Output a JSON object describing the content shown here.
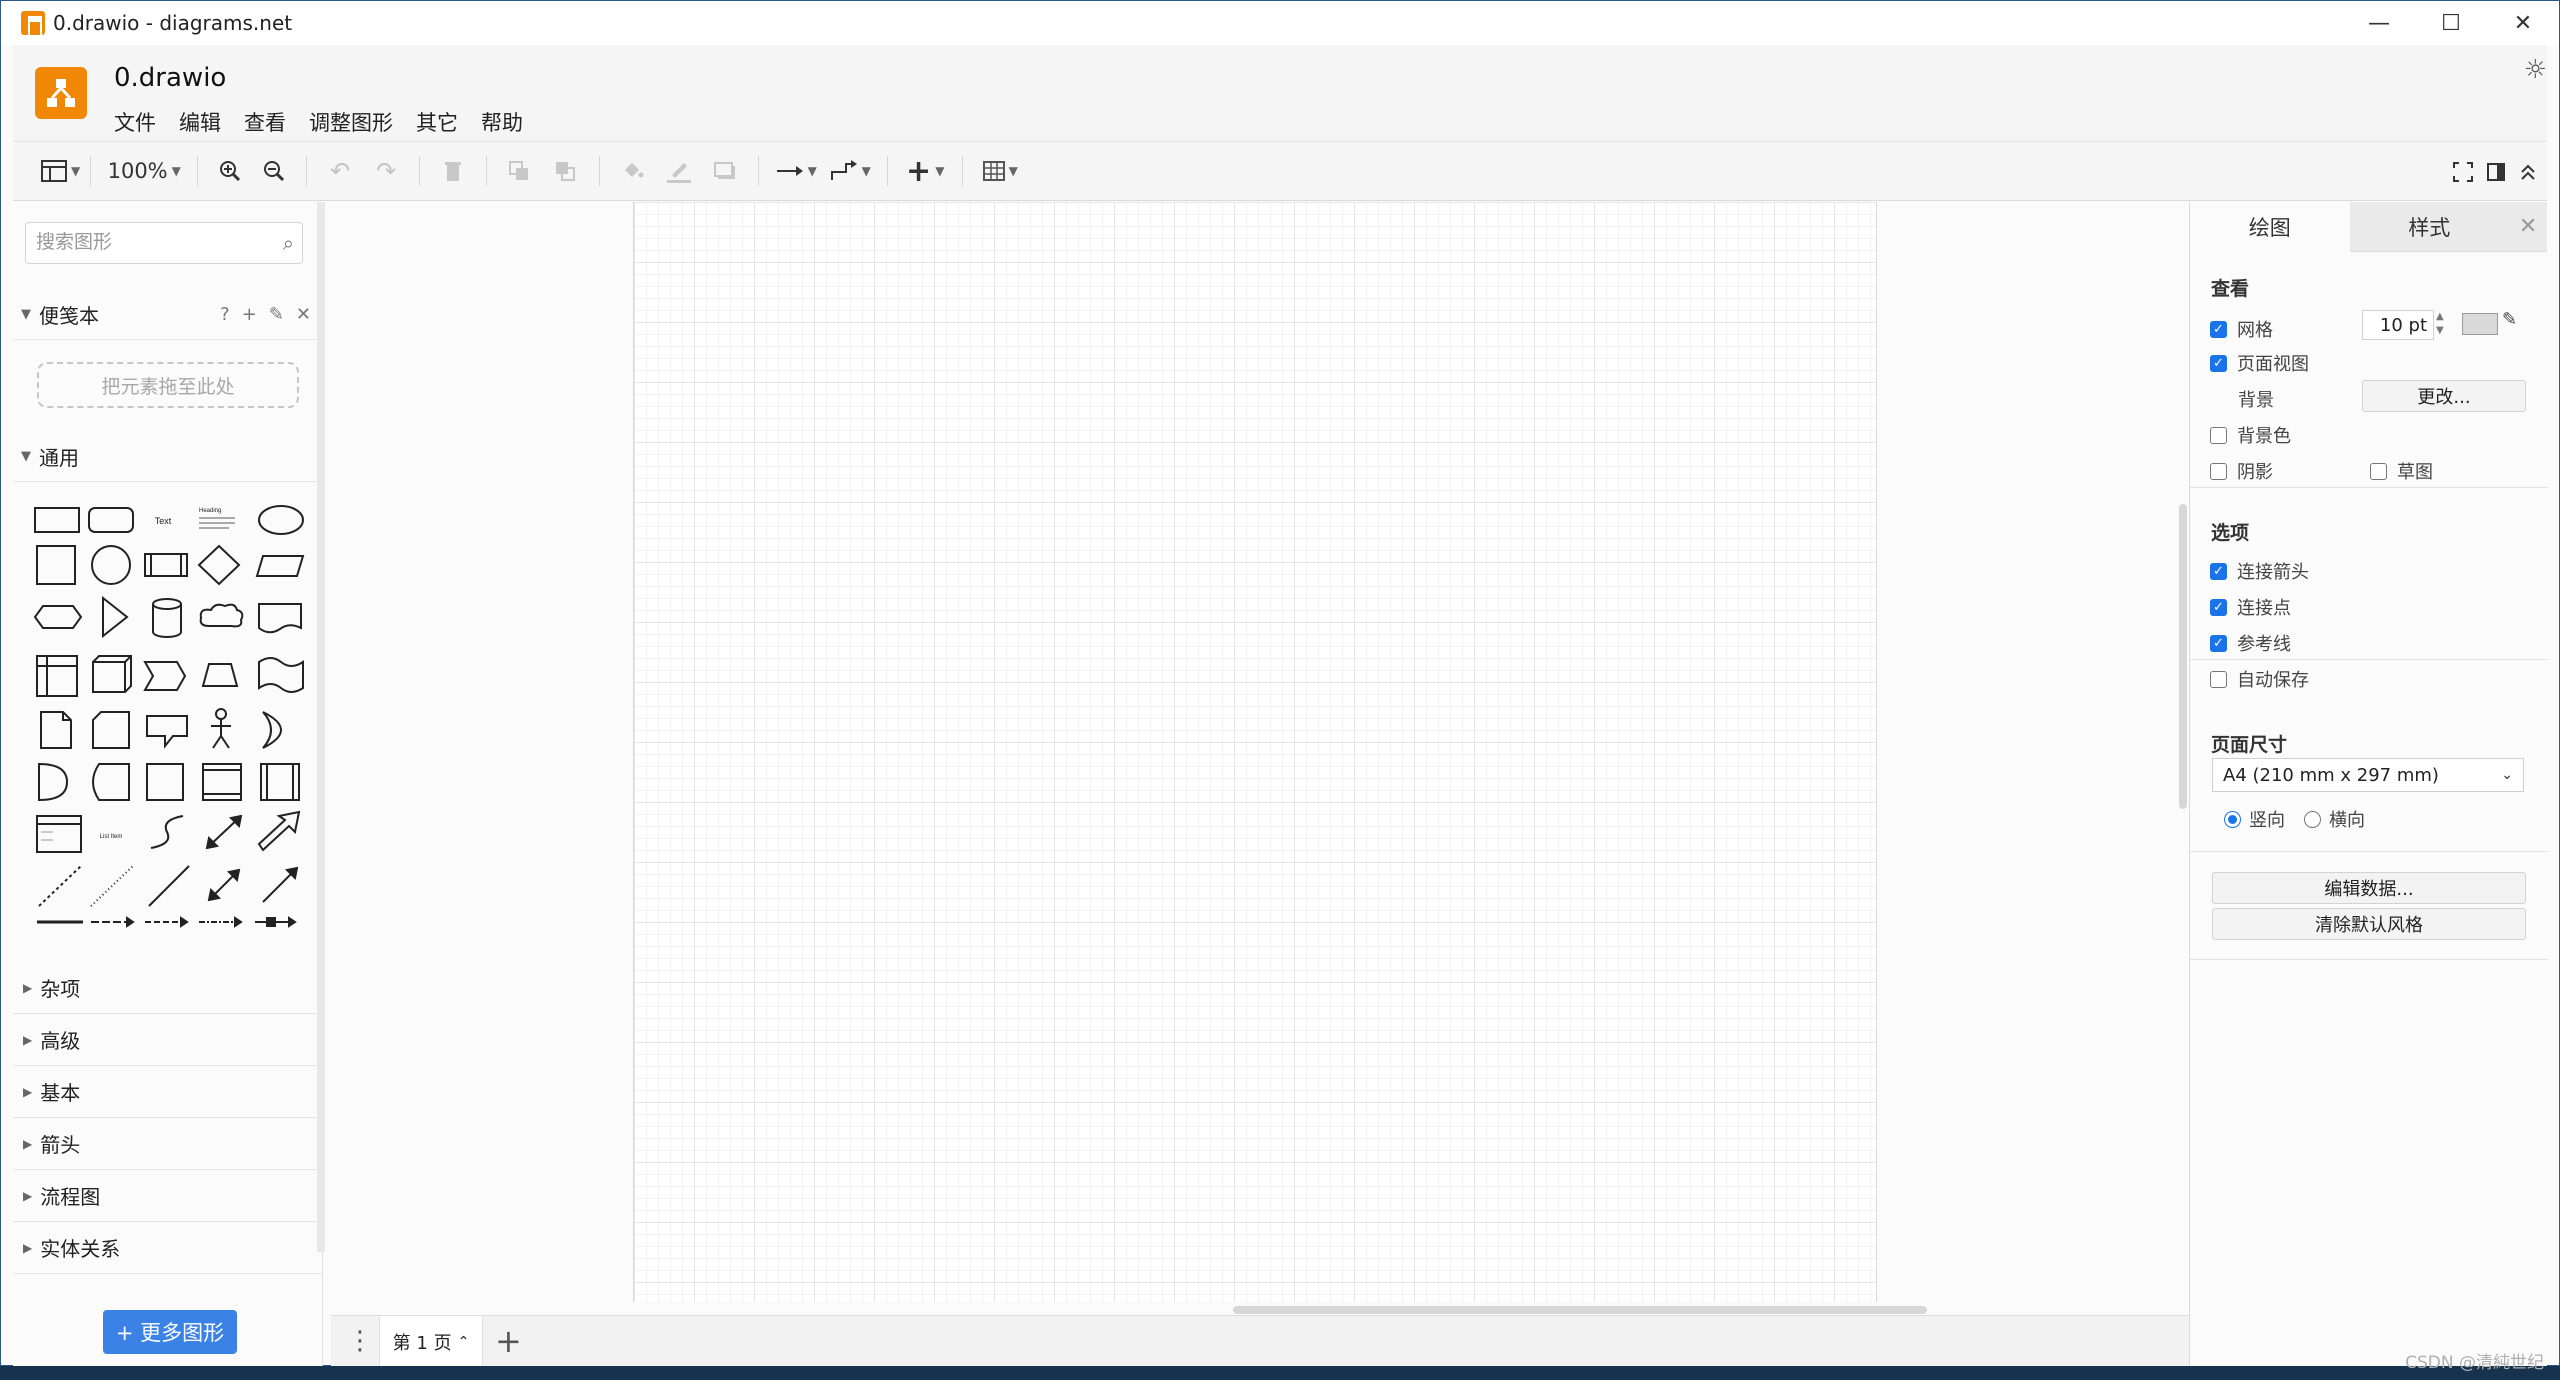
{
  "window": {
    "title": "0.drawio - diagrams.net",
    "controls": [
      "—",
      "☐",
      "✕"
    ]
  },
  "header": {
    "doc_name": "0.drawio",
    "menus": [
      "文件",
      "编辑",
      "查看",
      "调整图形",
      "其它",
      "帮助"
    ],
    "theme_icon": "sun-icon"
  },
  "toolbar": {
    "zoom": "100%",
    "icons": [
      "sidebar-layout-icon",
      "zoom-in-icon",
      "zoom-out-icon",
      "undo-icon",
      "redo-icon",
      "delete-icon",
      "to-front-icon",
      "to-back-icon",
      "fill-color-icon",
      "line-color-icon",
      "shadow-icon",
      "connection-icon",
      "waypoints-icon",
      "insert-plus-icon",
      "table-icon",
      "fullscreen-icon",
      "format-panel-icon",
      "collapse-icon"
    ]
  },
  "sidebar": {
    "search_placeholder": "搜索图形",
    "scratchpad": {
      "label": "便笺本",
      "actions": [
        "?",
        "+",
        "✎",
        "✕"
      ],
      "drop_hint": "把元素拖至此处"
    },
    "general_label": "通用",
    "shape_text_sample": "Text",
    "shape_heading_sample": "Heading",
    "shape_list_sample": "List Item",
    "sections": [
      "杂项",
      "高级",
      "基本",
      "箭头",
      "流程图",
      "实体关系"
    ],
    "more_shapes": "+ 更多图形"
  },
  "pages": {
    "current": "第 1 页",
    "caret": "⌃",
    "add": "+"
  },
  "format_panel": {
    "tabs": [
      "绘图",
      "样式"
    ],
    "close": "✕",
    "view_section": {
      "title": "查看",
      "grid": {
        "label": "网格",
        "checked": true,
        "size": "10 pt"
      },
      "page_view": {
        "label": "页面视图",
        "checked": true
      },
      "background_label": "背景",
      "change_button": "更改...",
      "background_color": {
        "label": "背景色",
        "checked": false
      },
      "shadow": {
        "label": "阴影",
        "checked": false
      },
      "sketch": {
        "label": "草图",
        "checked": false
      }
    },
    "options_section": {
      "title": "选项",
      "items": [
        {
          "label": "连接箭头",
          "checked": true
        },
        {
          "label": "连接点",
          "checked": true
        },
        {
          "label": "参考线",
          "checked": true
        },
        {
          "label": "自动保存",
          "checked": false
        }
      ]
    },
    "page_size_section": {
      "title": "页面尺寸",
      "selected": "A4 (210 mm x 297 mm)",
      "portrait": "竖向",
      "landscape": "横向",
      "orientation": "portrait"
    },
    "buttons": [
      "编辑数据...",
      "清除默认风格"
    ],
    "grid_color": "#d9d9d9"
  },
  "watermark": "CSDN @清純世纪"
}
